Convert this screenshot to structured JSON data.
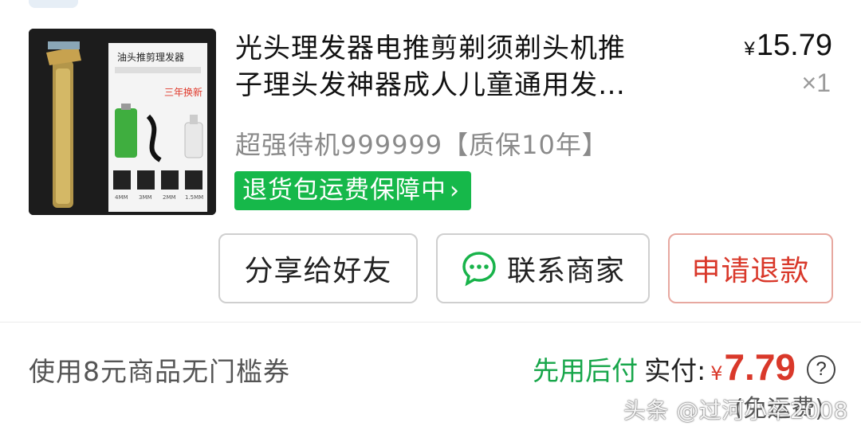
{
  "product": {
    "title_line1": "光头理发器电推剪剃须剃头机推",
    "title_line2": "子理头发神器成人儿童通用发…",
    "spec": "超强待机999999【质保10年】",
    "badge_label": "退货包运费保障中",
    "badge_icon": "chevron-right-icon",
    "price_symbol": "¥",
    "price": "15.79",
    "quantity": "×1",
    "thumb_text": {
      "box_title": "油头推剪理发器",
      "sticker": "三年换新",
      "guides": [
        "4MM",
        "3MM",
        "2MM",
        "1.5MM"
      ]
    }
  },
  "actions": {
    "share_label": "分享给好友",
    "contact_label": "联系商家",
    "contact_icon": "chat-bubble-icon",
    "refund_label": "申请退款"
  },
  "summary": {
    "coupon_text": "使用8元商品无门槛券",
    "pay_later": "先用后付",
    "paid_label": "实付:",
    "paid_symbol": "¥",
    "paid_amount": "7.79",
    "help_icon": "question-circle-icon",
    "shipping_note": "(免运费)"
  },
  "watermark": "头条 @过河小卒2008",
  "colors": {
    "accent_red": "#d9382a",
    "accent_green": "#16b84a",
    "pay_later_green": "#17a64a"
  }
}
